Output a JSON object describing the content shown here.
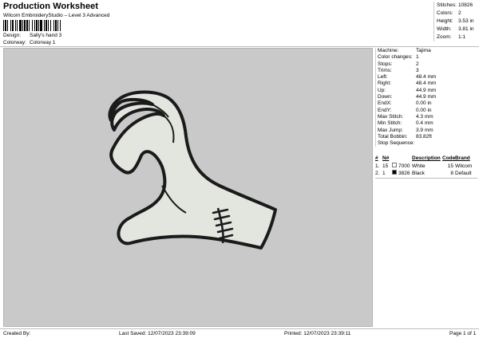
{
  "header": {
    "title": "Production Worksheet",
    "subtitle": "Wilcom EmbroideryStudio – Level 3 Advanced"
  },
  "design": {
    "design_label": "Design:",
    "design_value": "Sally's hand 3",
    "colorway_label": "Colorway:",
    "colorway_value": "Colorway 1"
  },
  "stats": [
    {
      "label": "Stitches:",
      "value": "10826"
    },
    {
      "label": "Colors:",
      "value": "2"
    },
    {
      "label": "Height:",
      "value": "3.53 in"
    },
    {
      "label": "Width:",
      "value": "3.81 in"
    },
    {
      "label": "Zoom:",
      "value": "1:1"
    }
  ],
  "machine_info": [
    {
      "label": "Machine:",
      "value": "Tajima"
    },
    {
      "label": "Color changes:",
      "value": "1"
    },
    {
      "label": "Stops:",
      "value": "2"
    },
    {
      "label": "Trims:",
      "value": "3"
    },
    {
      "label": "Left:",
      "value": "48.4 mm"
    },
    {
      "label": "Right:",
      "value": "48.4 mm"
    },
    {
      "label": "Up:",
      "value": "44.9 mm"
    },
    {
      "label": "Down:",
      "value": "44.9 mm"
    },
    {
      "label": "EndX:",
      "value": "0.00 in"
    },
    {
      "label": "EndY:",
      "value": "0.00 in"
    },
    {
      "label": "Max Stitch:",
      "value": "4.3 mm"
    },
    {
      "label": "Min Stitch:",
      "value": "0.4 mm"
    },
    {
      "label": "Max Jump:",
      "value": "3.9 mm"
    },
    {
      "label": "Total Bobbin:",
      "value": "83.82ft"
    }
  ],
  "stop_sequence": {
    "title": "Stop Sequence:",
    "headers": {
      "num": "#",
      "n": "N#",
      "desc": "Description",
      "code": "Code",
      "brand": "Brand"
    },
    "rows": [
      {
        "num": "1.",
        "n": "15",
        "color": "#ffffff",
        "code": "7000",
        "desc": "White",
        "code2": "15",
        "brand": "Wilcom"
      },
      {
        "num": "2.",
        "n": "1",
        "color": "#000000",
        "code": "3826",
        "desc": "Black",
        "code2": "8",
        "brand": "Default"
      }
    ]
  },
  "footer": {
    "created_by": "Created By:",
    "last_saved": "Last Saved: 12/07/2023 23:39:09",
    "printed": "Printed: 12/07/2023 23:39:11",
    "page": "Page 1 of 1"
  }
}
